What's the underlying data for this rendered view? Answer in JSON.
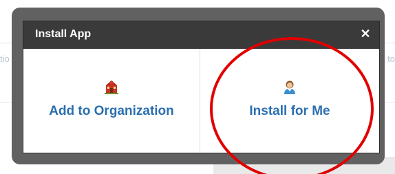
{
  "background": {
    "left_fragment": "tio",
    "right_fragment": "to"
  },
  "dialog": {
    "title": "Install App",
    "close_glyph": "✕",
    "options": [
      {
        "label": "Add to Organization",
        "icon": "school-building-icon"
      },
      {
        "label": "Install for Me",
        "icon": "user-person-icon"
      }
    ]
  },
  "colors": {
    "header_bg": "#3a3a3a",
    "frame": "#5b5b5b",
    "link_blue": "#2a6fb0",
    "annotation_red": "#e00000"
  }
}
